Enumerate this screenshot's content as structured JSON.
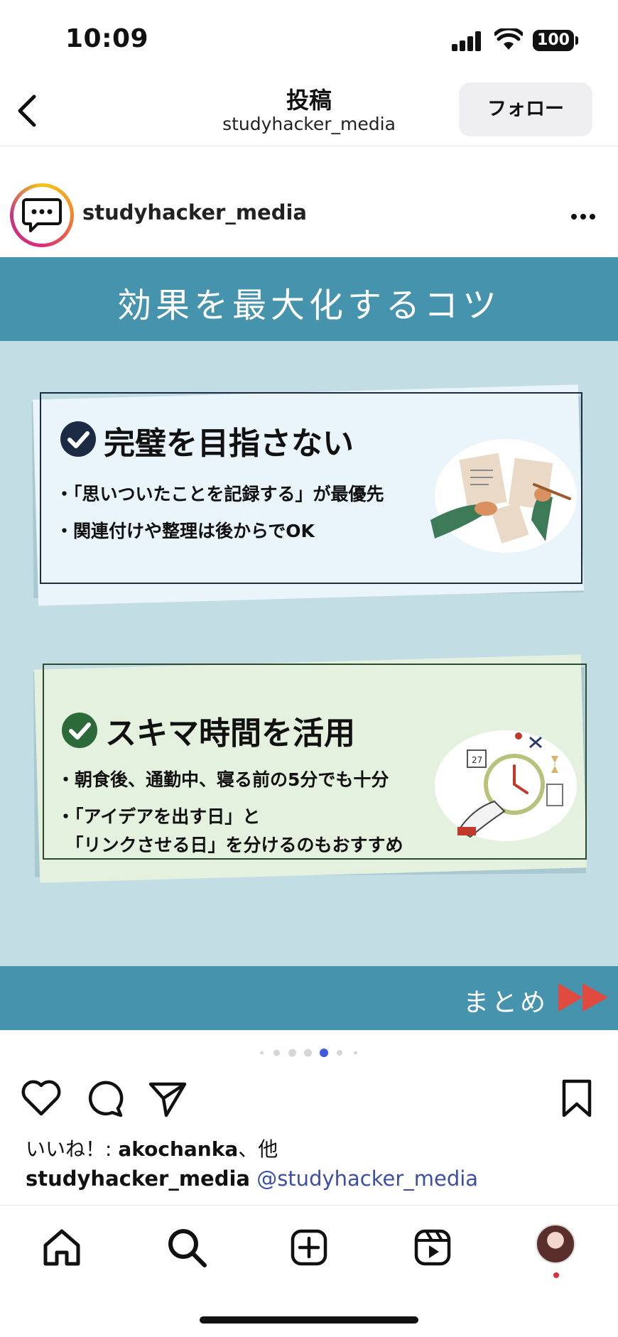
{
  "status_bar": {
    "time": "10:09",
    "battery": "100",
    "icons": [
      "signal-icon",
      "wifi-icon",
      "battery-icon"
    ]
  },
  "header": {
    "title": "投稿",
    "subtitle": "studyhacker_media",
    "follow_label": "フォロー",
    "back_icon": "chevron-left-icon"
  },
  "post": {
    "username": "studyhacker_media",
    "more_icon": "more-horizontal-icon"
  },
  "slide": {
    "title": "効果を最大化するコツ",
    "card1": {
      "heading": "完璧を目指さない",
      "bullets": [
        "・「思いついたことを記録する」が最優先",
        "・関連付けや整理は後からでOK"
      ]
    },
    "card2": {
      "heading": "スキマ時間を活用",
      "bullets": [
        "・朝食後、通勤中、寝る前の5分でも十分",
        "・「アイデアを出す日」と",
        "　「リンクさせる日」を分けるのもおすすめ"
      ]
    },
    "footer_label": "まとめ",
    "colors": {
      "banner": "#4593ad",
      "background": "#c3dde4",
      "card1": "#e9f4fb",
      "card2": "#e5f1df",
      "arrow": "#e04a3f"
    }
  },
  "carousel": {
    "dot_count": 7,
    "active_index": 4,
    "active_color": "#3f5bd9"
  },
  "actions": {
    "icons": [
      "heart-icon",
      "comment-icon",
      "share-icon",
      "bookmark-icon"
    ]
  },
  "likes": {
    "prefix": "いいね！: ",
    "user": "akochanka",
    "suffix": "、他"
  },
  "caption": {
    "user": "studyhacker_media",
    "mention": "@studyhacker_media"
  },
  "bottom_nav": {
    "icons": [
      "home-icon",
      "search-icon",
      "create-icon",
      "reels-icon",
      "profile-avatar"
    ]
  }
}
